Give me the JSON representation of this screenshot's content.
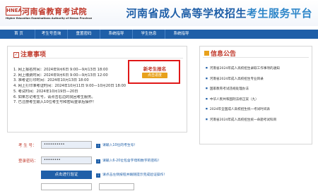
{
  "header": {
    "logo_mark": "HNEA",
    "site_name": "河南省教育考试院",
    "site_name_en": "Higher Education Examinations Authority of Henan Province",
    "platform_title_a": "河南省成人高等学校招生",
    "platform_title_b": "考生服务平台"
  },
  "nav": {
    "items": [
      "首 页",
      "考生号查询",
      "重置密码",
      "系统指导",
      "学生信息",
      "系统指导"
    ]
  },
  "notice": {
    "title": "注意事项",
    "items": [
      "1. 网上报名时间：2024年9月6日 9:00—9月13日 18:00",
      "2. 网上缴费时间：2024年9月6日 9:00—9月13日 12:00",
      "3. 准考证打印时间：2024年10月13日 18:00",
      "4. 网上打印准考证时间：2024年10月11日 9:00—10月20日 18:00",
      "5. 考试时间：2024年10月19日—20日",
      "6. 如果忘记考生号，请点击右边的找回考生服务。",
      "7. 已注册考生输入10位考生号和密码登录后操作！"
    ],
    "register_title": "新考生报名",
    "register_button": "点击进度"
  },
  "announcements": {
    "title": "信息公告",
    "items": [
      "河南省2024年成人高校招生录取工作事项的通知",
      "河南省2024年成人高校招生专业目录",
      "国家教育考试违规处理办法",
      "中华人民共和国刑法修正案（九）",
      "2024年全国成人高校招生统一考试时间表",
      "河南省2024年成人高校招生统一命题考试科目"
    ]
  },
  "form": {
    "student_id_label": "考 生 号：",
    "student_id_value": "••••••••••",
    "student_id_hint": "请输入10位的考生号！",
    "password_label": "登录密码：",
    "password_value": "••••••••",
    "password_hint": "请输入6-20位包含字母和数字的密码！",
    "verify_button": "点击进行验证",
    "verify_hint": "请点击左侧按钮并跟随提示完成验证操作！"
  },
  "colors": {
    "brand_blue": "#1f5fa8",
    "accent_red": "#c0392b",
    "highlight_box": "#e01818",
    "button_orange": "#e8a11c"
  }
}
